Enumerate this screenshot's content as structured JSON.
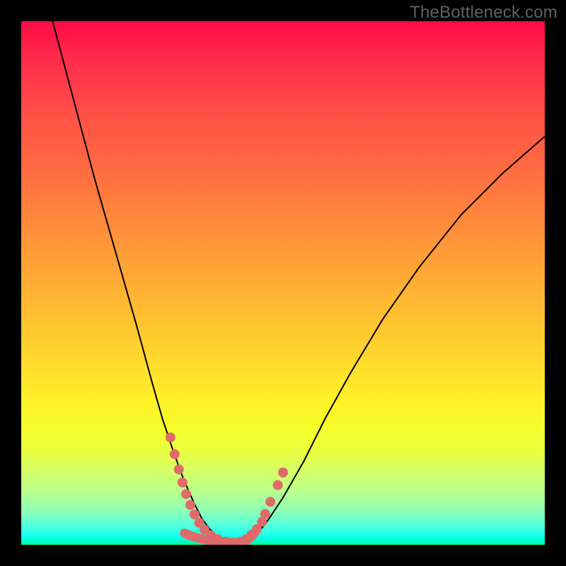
{
  "attribution": "TheBottleneck.com",
  "chart_data": {
    "type": "line",
    "title": "",
    "xlabel": "",
    "ylabel": "",
    "xlim": [
      0,
      100
    ],
    "ylim": [
      0,
      100
    ],
    "gradient_stops": [
      {
        "pos": 0,
        "color": "#ff0b47"
      },
      {
        "pos": 8,
        "color": "#ff2f4a"
      },
      {
        "pos": 18,
        "color": "#ff5146"
      },
      {
        "pos": 30,
        "color": "#ff7140"
      },
      {
        "pos": 40,
        "color": "#ff8f3a"
      },
      {
        "pos": 50,
        "color": "#ffad34"
      },
      {
        "pos": 62,
        "color": "#ffd12e"
      },
      {
        "pos": 72,
        "color": "#fff028"
      },
      {
        "pos": 78,
        "color": "#f6ff2c"
      },
      {
        "pos": 82,
        "color": "#e9ff3e"
      },
      {
        "pos": 86,
        "color": "#d3ff66"
      },
      {
        "pos": 90,
        "color": "#b7ff8e"
      },
      {
        "pos": 93.5,
        "color": "#8fffb6"
      },
      {
        "pos": 96,
        "color": "#5bffd8"
      },
      {
        "pos": 98,
        "color": "#1fffec"
      },
      {
        "pos": 99,
        "color": "#00ffe0"
      },
      {
        "pos": 99.5,
        "color": "#00ffb8"
      },
      {
        "pos": 100,
        "color": "#00ff8e"
      }
    ],
    "series": [
      {
        "name": "bottleneck-curve",
        "x": [
          6,
          10,
          14,
          18,
          22,
          25,
          27,
          29,
          31,
          33,
          34.5,
          36,
          37.5,
          39,
          41,
          43,
          45,
          47,
          50,
          54,
          58,
          63,
          69,
          76,
          84,
          92,
          100
        ],
        "y": [
          100,
          85,
          70,
          56,
          42,
          31,
          24,
          18,
          12.5,
          8,
          5,
          3,
          1.5,
          0.8,
          0.4,
          0.8,
          2,
          4.5,
          9,
          16,
          24,
          33,
          43,
          53,
          63,
          71,
          78
        ]
      }
    ],
    "markers": {
      "color": "#e06a6a",
      "points": [
        {
          "x": 28.5,
          "y": 20.5
        },
        {
          "x": 29.3,
          "y": 17.3
        },
        {
          "x": 30.1,
          "y": 14.4
        },
        {
          "x": 30.8,
          "y": 11.9
        },
        {
          "x": 31.5,
          "y": 9.7
        },
        {
          "x": 32.3,
          "y": 7.6
        },
        {
          "x": 33.1,
          "y": 5.8
        },
        {
          "x": 34.0,
          "y": 4.2
        },
        {
          "x": 35.0,
          "y": 2.9
        },
        {
          "x": 36.2,
          "y": 1.8
        },
        {
          "x": 37.5,
          "y": 1.1
        },
        {
          "x": 39.0,
          "y": 0.6
        },
        {
          "x": 40.5,
          "y": 0.4
        },
        {
          "x": 42.0,
          "y": 0.6
        },
        {
          "x": 43.0,
          "y": 1.1
        },
        {
          "x": 44.0,
          "y": 1.9
        },
        {
          "x": 45.0,
          "y": 3.0
        },
        {
          "x": 46.0,
          "y": 4.4
        },
        {
          "x": 46.6,
          "y": 5.9
        },
        {
          "x": 47.6,
          "y": 8.2
        },
        {
          "x": 49.0,
          "y": 11.4
        },
        {
          "x": 50.0,
          "y": 13.8
        }
      ]
    },
    "valley_path": [
      {
        "x": 31.2,
        "y": 2.2
      },
      {
        "x": 33.0,
        "y": 1.5
      },
      {
        "x": 36.0,
        "y": 0.7
      },
      {
        "x": 39.0,
        "y": 0.4
      },
      {
        "x": 41.5,
        "y": 0.4
      },
      {
        "x": 43.0,
        "y": 0.8
      },
      {
        "x": 44.0,
        "y": 1.6
      },
      {
        "x": 44.8,
        "y": 2.6
      }
    ]
  }
}
